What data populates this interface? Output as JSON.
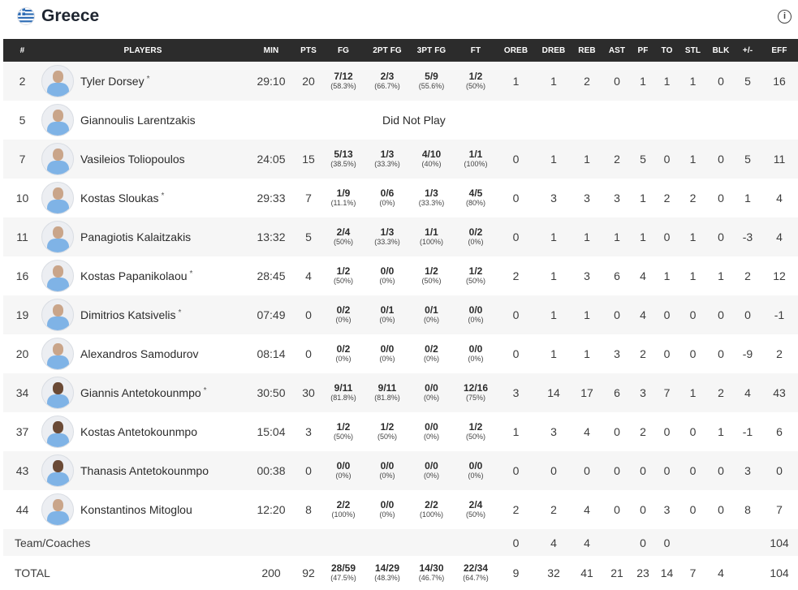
{
  "team": {
    "name": "Greece"
  },
  "columns": [
    "#",
    "PLAYERS",
    "MIN",
    "PTS",
    "FG",
    "2PT FG",
    "3PT FG",
    "FT",
    "OREB",
    "DREB",
    "REB",
    "AST",
    "PF",
    "TO",
    "STL",
    "BLK",
    "+/-",
    "EFF"
  ],
  "colors": {
    "header_bg": "#2c2c2c",
    "row_alt": "#f6f6f6",
    "jersey": "#7fb3e6"
  },
  "players": [
    {
      "num": "2",
      "name": "Tyler Dorsey",
      "starter": "*",
      "min": "29:10",
      "pts": "20",
      "fg": "7/12",
      "fg_pct": "(58.3%)",
      "fg2": "2/3",
      "fg2_pct": "(66.7%)",
      "fg3": "5/9",
      "fg3_pct": "(55.6%)",
      "ft": "1/2",
      "ft_pct": "(50%)",
      "oreb": "1",
      "dreb": "1",
      "reb": "2",
      "ast": "0",
      "pf": "1",
      "to": "1",
      "stl": "1",
      "blk": "0",
      "pm": "5",
      "eff": "16"
    },
    {
      "num": "5",
      "name": "Giannoulis Larentzakis",
      "starter": "",
      "dnp": "Did Not Play"
    },
    {
      "num": "7",
      "name": "Vasileios Toliopoulos",
      "starter": "",
      "min": "24:05",
      "pts": "15",
      "fg": "5/13",
      "fg_pct": "(38.5%)",
      "fg2": "1/3",
      "fg2_pct": "(33.3%)",
      "fg3": "4/10",
      "fg3_pct": "(40%)",
      "ft": "1/1",
      "ft_pct": "(100%)",
      "oreb": "0",
      "dreb": "1",
      "reb": "1",
      "ast": "2",
      "pf": "5",
      "to": "0",
      "stl": "1",
      "blk": "0",
      "pm": "5",
      "eff": "11"
    },
    {
      "num": "10",
      "name": "Kostas Sloukas",
      "starter": "*",
      "min": "29:33",
      "pts": "7",
      "fg": "1/9",
      "fg_pct": "(11.1%)",
      "fg2": "0/6",
      "fg2_pct": "(0%)",
      "fg3": "1/3",
      "fg3_pct": "(33.3%)",
      "ft": "4/5",
      "ft_pct": "(80%)",
      "oreb": "0",
      "dreb": "3",
      "reb": "3",
      "ast": "3",
      "pf": "1",
      "to": "2",
      "stl": "2",
      "blk": "0",
      "pm": "1",
      "eff": "4"
    },
    {
      "num": "11",
      "name": "Panagiotis Kalaitzakis",
      "starter": "",
      "min": "13:32",
      "pts": "5",
      "fg": "2/4",
      "fg_pct": "(50%)",
      "fg2": "1/3",
      "fg2_pct": "(33.3%)",
      "fg3": "1/1",
      "fg3_pct": "(100%)",
      "ft": "0/2",
      "ft_pct": "(0%)",
      "oreb": "0",
      "dreb": "1",
      "reb": "1",
      "ast": "1",
      "pf": "1",
      "to": "0",
      "stl": "1",
      "blk": "0",
      "pm": "-3",
      "eff": "4"
    },
    {
      "num": "16",
      "name": "Kostas Papanikolaou",
      "starter": "*",
      "min": "28:45",
      "pts": "4",
      "fg": "1/2",
      "fg_pct": "(50%)",
      "fg2": "0/0",
      "fg2_pct": "(0%)",
      "fg3": "1/2",
      "fg3_pct": "(50%)",
      "ft": "1/2",
      "ft_pct": "(50%)",
      "oreb": "2",
      "dreb": "1",
      "reb": "3",
      "ast": "6",
      "pf": "4",
      "to": "1",
      "stl": "1",
      "blk": "1",
      "pm": "2",
      "eff": "12"
    },
    {
      "num": "19",
      "name": "Dimitrios Katsivelis",
      "starter": "*",
      "min": "07:49",
      "pts": "0",
      "fg": "0/2",
      "fg_pct": "(0%)",
      "fg2": "0/1",
      "fg2_pct": "(0%)",
      "fg3": "0/1",
      "fg3_pct": "(0%)",
      "ft": "0/0",
      "ft_pct": "(0%)",
      "oreb": "0",
      "dreb": "1",
      "reb": "1",
      "ast": "0",
      "pf": "4",
      "to": "0",
      "stl": "0",
      "blk": "0",
      "pm": "0",
      "eff": "-1"
    },
    {
      "num": "20",
      "name": "Alexandros Samodurov",
      "starter": "",
      "min": "08:14",
      "pts": "0",
      "fg": "0/2",
      "fg_pct": "(0%)",
      "fg2": "0/0",
      "fg2_pct": "(0%)",
      "fg3": "0/2",
      "fg3_pct": "(0%)",
      "ft": "0/0",
      "ft_pct": "(0%)",
      "oreb": "0",
      "dreb": "1",
      "reb": "1",
      "ast": "3",
      "pf": "2",
      "to": "0",
      "stl": "0",
      "blk": "0",
      "pm": "-9",
      "eff": "2"
    },
    {
      "num": "34",
      "name": "Giannis Antetokounmpo",
      "starter": "*",
      "min": "30:50",
      "pts": "30",
      "fg": "9/11",
      "fg_pct": "(81.8%)",
      "fg2": "9/11",
      "fg2_pct": "(81.8%)",
      "fg3": "0/0",
      "fg3_pct": "(0%)",
      "ft": "12/16",
      "ft_pct": "(75%)",
      "oreb": "3",
      "dreb": "14",
      "reb": "17",
      "ast": "6",
      "pf": "3",
      "to": "7",
      "stl": "1",
      "blk": "2",
      "pm": "4",
      "eff": "43"
    },
    {
      "num": "37",
      "name": "Kostas Antetokounmpo",
      "starter": "",
      "min": "15:04",
      "pts": "3",
      "fg": "1/2",
      "fg_pct": "(50%)",
      "fg2": "1/2",
      "fg2_pct": "(50%)",
      "fg3": "0/0",
      "fg3_pct": "(0%)",
      "ft": "1/2",
      "ft_pct": "(50%)",
      "oreb": "1",
      "dreb": "3",
      "reb": "4",
      "ast": "0",
      "pf": "2",
      "to": "0",
      "stl": "0",
      "blk": "1",
      "pm": "-1",
      "eff": "6"
    },
    {
      "num": "43",
      "name": "Thanasis Antetokounmpo",
      "starter": "",
      "min": "00:38",
      "pts": "0",
      "fg": "0/0",
      "fg_pct": "(0%)",
      "fg2": "0/0",
      "fg2_pct": "(0%)",
      "fg3": "0/0",
      "fg3_pct": "(0%)",
      "ft": "0/0",
      "ft_pct": "(0%)",
      "oreb": "0",
      "dreb": "0",
      "reb": "0",
      "ast": "0",
      "pf": "0",
      "to": "0",
      "stl": "0",
      "blk": "0",
      "pm": "3",
      "eff": "0"
    },
    {
      "num": "44",
      "name": "Konstantinos Mitoglou",
      "starter": "",
      "min": "12:20",
      "pts": "8",
      "fg": "2/2",
      "fg_pct": "(100%)",
      "fg2": "0/0",
      "fg2_pct": "(0%)",
      "fg3": "2/2",
      "fg3_pct": "(100%)",
      "ft": "2/4",
      "ft_pct": "(50%)",
      "oreb": "2",
      "dreb": "2",
      "reb": "4",
      "ast": "0",
      "pf": "0",
      "to": "3",
      "stl": "0",
      "blk": "0",
      "pm": "8",
      "eff": "7"
    }
  ],
  "team_coaches": {
    "label": "Team/Coaches",
    "oreb": "0",
    "dreb": "4",
    "reb": "4",
    "pf": "0",
    "to": "0",
    "eff": "104"
  },
  "total": {
    "label": "TOTAL",
    "min": "200",
    "pts": "92",
    "fg": "28/59",
    "fg_pct": "(47.5%)",
    "fg2": "14/29",
    "fg2_pct": "(48.3%)",
    "fg3": "14/30",
    "fg3_pct": "(46.7%)",
    "ft": "22/34",
    "ft_pct": "(64.7%)",
    "oreb": "9",
    "dreb": "32",
    "reb": "41",
    "ast": "21",
    "pf": "23",
    "to": "14",
    "stl": "7",
    "blk": "4",
    "eff": "104"
  }
}
